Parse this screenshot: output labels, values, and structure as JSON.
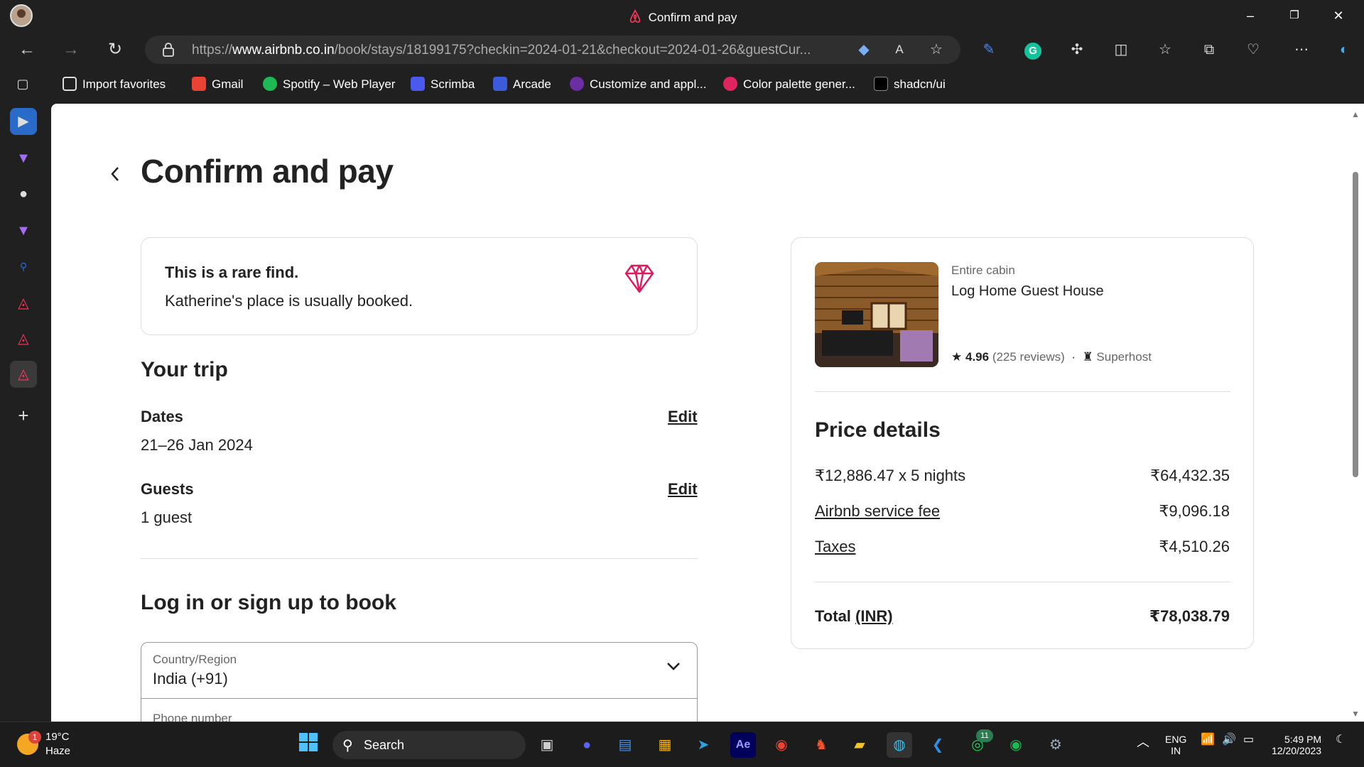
{
  "window": {
    "title": "Confirm and pay"
  },
  "browser": {
    "url_domain": "www.airbnb.co.in",
    "url_prefix": "https://",
    "url_path": "/book/stays/18199175?checkin=2024-01-21&checkout=2024-01-26&guestCur...",
    "favorites": [
      {
        "label": "Import favorites",
        "icon": "import-icon",
        "color": "#ffffff"
      },
      {
        "label": "Gmail",
        "icon": "gmail-icon",
        "color": "#ea4335"
      },
      {
        "label": "Spotify – Web Player",
        "icon": "spotify-icon",
        "color": "#1db954"
      },
      {
        "label": "Scrimba",
        "icon": "scrimba-icon",
        "color": "#4a5aef"
      },
      {
        "label": "Arcade",
        "icon": "arcade-icon",
        "color": "#3b5bdb"
      },
      {
        "label": "Customize and appl...",
        "icon": "crown-icon",
        "color": "#6b2fa3"
      },
      {
        "label": "Color palette gener...",
        "icon": "g-icon",
        "color": "#e0245e"
      },
      {
        "label": "shadcn/ui",
        "icon": "shadcn-icon",
        "color": "#000000"
      }
    ]
  },
  "page": {
    "title": "Confirm and pay",
    "rare": {
      "title": "This is a rare find.",
      "text": "Katherine's place is usually booked."
    },
    "trip": {
      "heading": "Your trip",
      "dates_label": "Dates",
      "dates_value": "21–26 Jan 2024",
      "guests_label": "Guests",
      "guests_value": "1 guest",
      "edit_label": "Edit"
    },
    "login": {
      "heading": "Log in or sign up to book",
      "country_label": "Country/Region",
      "country_value": "India (+91)",
      "phone_label": "Phone number"
    }
  },
  "listing": {
    "type": "Entire cabin",
    "name": "Log Home Guest House",
    "rating": "4.96",
    "reviews": "(225 reviews)",
    "separator": "·",
    "superhost": "Superhost"
  },
  "price": {
    "heading": "Price details",
    "rows": [
      {
        "label": "₹12,886.47 x 5 nights",
        "value": "₹64,432.35"
      },
      {
        "label": "Airbnb service fee",
        "value": "₹9,096.18"
      },
      {
        "label": "Taxes",
        "value": "₹4,510.26"
      }
    ],
    "total_label": "Total",
    "total_currency": "(INR)",
    "total_value": "₹78,038.79"
  },
  "taskbar": {
    "temp": "19°C",
    "condition": "Haze",
    "weather_badge": "1",
    "search": "Search",
    "whatsapp_badge": "11",
    "lang1": "ENG",
    "lang2": "IN",
    "time": "5:49 PM",
    "date": "12/20/2023"
  },
  "colors": {
    "airbnb": "#ff385c",
    "accent": "#e0185e"
  }
}
